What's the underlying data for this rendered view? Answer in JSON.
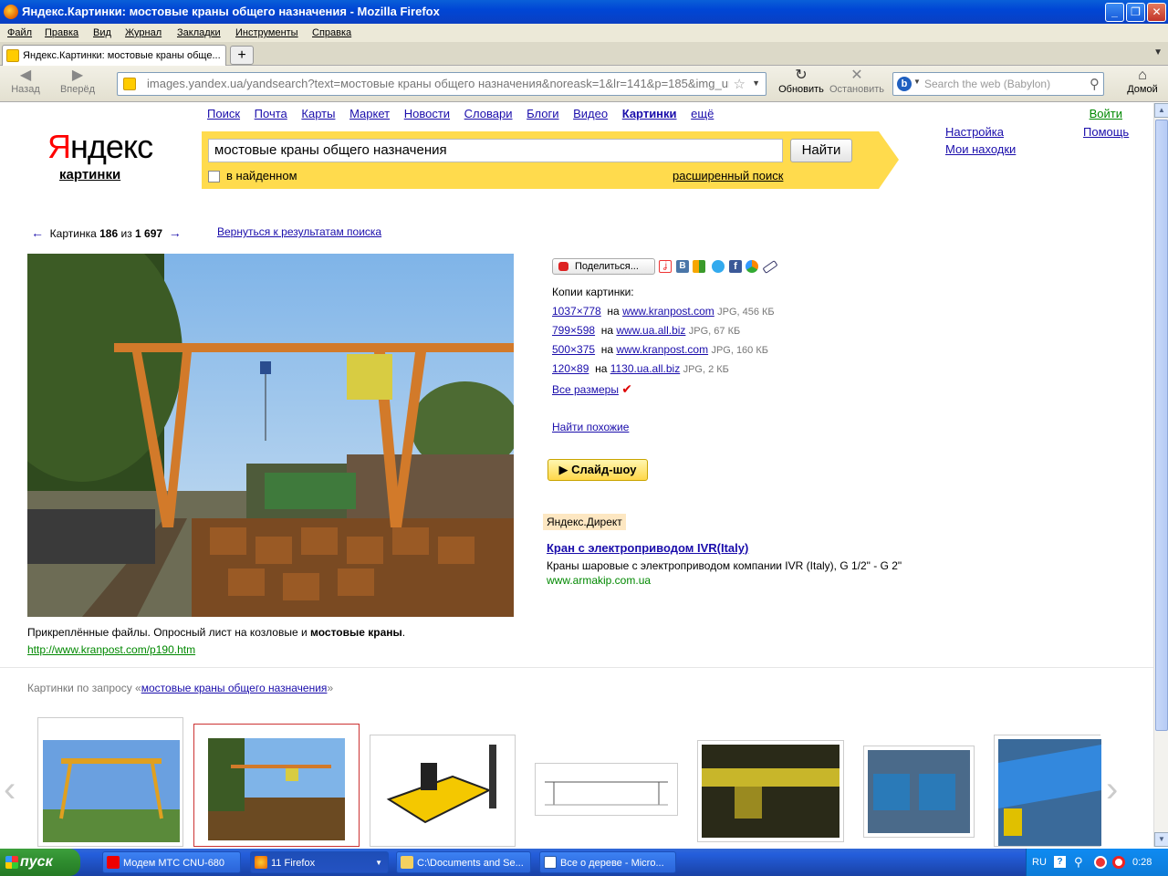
{
  "window": {
    "title": "Яндекс.Картинки: мостовые краны общего назначения - Mozilla Firefox",
    "buttons": [
      "_",
      "❐",
      "✕"
    ]
  },
  "menu": [
    "Файл",
    "Правка",
    "Вид",
    "Журнал",
    "Закладки",
    "Инструменты",
    "Справка"
  ],
  "tab": {
    "title": "Яндекс.Картинки: мостовые краны обще...",
    "new_tab": "+"
  },
  "nav": {
    "back": "Назад",
    "forward": "Вперёд",
    "url": "images.yandex.ua/yandsearch?text=мостовые краны общего назначения&noreask=1&lr=141&p=185&img_url=",
    "reload": "Обновить",
    "stop": "Остановить",
    "search_placeholder": "Search the web (Babylon)",
    "home": "Домой"
  },
  "yandex": {
    "logo_y": "Я",
    "logo_rest": "ндекс",
    "logo_sub": "картинки",
    "services": [
      "Поиск",
      "Почта",
      "Карты",
      "Маркет",
      "Новости",
      "Словари",
      "Блоги",
      "Видео",
      "Картинки",
      "ещё"
    ],
    "login": "Войти",
    "query": "мостовые краны общего назначения",
    "find_button": "Найти",
    "in_found": "в найденном",
    "advanced": "расширенный поиск",
    "settings": "Настройка",
    "my_finds": "Мои находки",
    "help": "Помощь"
  },
  "pager": {
    "prev_arrow": "←",
    "label": "Картинка",
    "current": "186",
    "of": "из",
    "total": "1 697",
    "next_arrow": "→",
    "back_link": "Вернуться к результатам поиска"
  },
  "image": {
    "caption_plain": "Прикреплённые файлы. Опросный лист на козловые и ",
    "caption_bold": "мостовые краны",
    "caption_end": ".",
    "url": "http://www.kranpost.com/p190.htm"
  },
  "share": {
    "label": "Поделиться..."
  },
  "copies": {
    "heading": "Копии картинки:",
    "items": [
      {
        "size": "1037×778",
        "on": "на",
        "site": "www.kranpost.com",
        "meta": "JPG, 456 КБ"
      },
      {
        "size": "799×598",
        "on": "на",
        "site": "www.ua.all.biz",
        "meta": "JPG, 67 КБ"
      },
      {
        "size": "500×375",
        "on": "на",
        "site": "www.kranpost.com",
        "meta": "JPG, 160 КБ"
      },
      {
        "size": "120×89",
        "on": "на",
        "site": "1130.ua.all.biz",
        "meta": "JPG, 2 КБ"
      }
    ],
    "all_sizes": "Все размеры",
    "find_similar": "Найти похожие"
  },
  "slideshow": "▶ Слайд-шоу",
  "ad": {
    "label": "Яндекс.Директ",
    "title": "Кран с электроприводом IVR(Italy)",
    "text": "Краны шаровые с электроприводом компании IVR (Italy), G 1/2\" - G 2\"",
    "url": "www.armakip.com.ua"
  },
  "related": {
    "prefix": "Картинки по запросу «",
    "query": "мостовые краны общего назначения",
    "suffix": "»"
  },
  "taskbar": {
    "start": "пуск",
    "items": [
      "Модем МТС CNU-680",
      "11 Firefox",
      "C:\\Documents and Se...",
      "Все о дереве - Micro..."
    ],
    "lang": "RU",
    "clock": "0:28"
  },
  "colors": {
    "brand_red": "#ff0000",
    "search_yellow": "#ffdb4d",
    "link": "#1a0dab",
    "url_green": "#008000"
  }
}
